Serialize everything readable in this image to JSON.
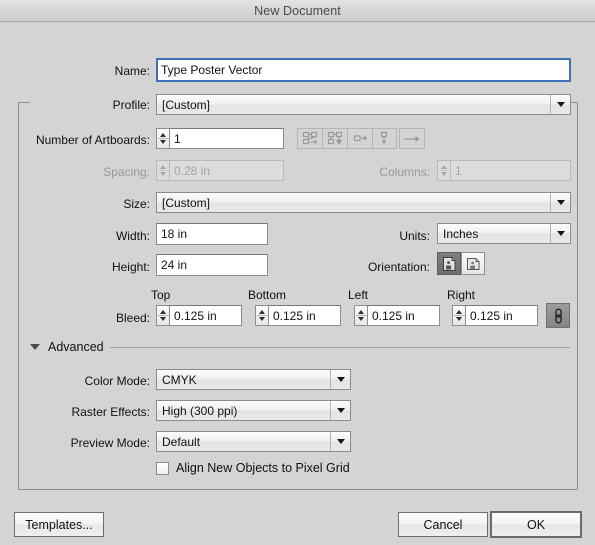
{
  "window": {
    "title": "New Document"
  },
  "fields": {
    "name_label": "Name:",
    "name_value": "Type Poster Vector",
    "profile_label": "Profile:",
    "profile_value": "[Custom]",
    "artboards_label": "Number of Artboards:",
    "artboards_value": "1",
    "spacing_label": "Spacing:",
    "spacing_value": "0.28 in",
    "columns_label": "Columns:",
    "columns_value": "1",
    "size_label": "Size:",
    "size_value": "[Custom]",
    "width_label": "Width:",
    "width_value": "18 in",
    "height_label": "Height:",
    "height_value": "24 in",
    "units_label": "Units:",
    "units_value": "Inches",
    "orientation_label": "Orientation:"
  },
  "bleed": {
    "label": "Bleed:",
    "top_label": "Top",
    "bottom_label": "Bottom",
    "left_label": "Left",
    "right_label": "Right",
    "top_value": "0.125 in",
    "bottom_value": "0.125 in",
    "left_value": "0.125 in",
    "right_value": "0.125 in"
  },
  "advanced": {
    "section_label": "Advanced",
    "color_mode_label": "Color Mode:",
    "color_mode_value": "CMYK",
    "raster_effects_label": "Raster Effects:",
    "raster_effects_value": "High (300 ppi)",
    "preview_mode_label": "Preview Mode:",
    "preview_mode_value": "Default",
    "align_pixel_grid_label": "Align New Objects to Pixel Grid"
  },
  "buttons": {
    "templates": "Templates...",
    "cancel": "Cancel",
    "ok": "OK"
  },
  "icons": {
    "artboard_grid_row": "grid-by-row-icon",
    "artboard_grid_column": "grid-by-column-icon",
    "artboard_row": "arrange-by-row-icon",
    "artboard_column": "arrange-by-column-icon",
    "artboard_direction": "right-to-left-arrow-icon",
    "orientation_portrait": "portrait-orientation-icon",
    "orientation_landscape": "landscape-orientation-icon",
    "bleed_link": "link-chain-icon",
    "disclosure": "disclosure-triangle-icon"
  },
  "colors": {
    "background": "#d4d4d4",
    "focus_border": "#3f6fb5",
    "text": "#111111",
    "disabled_text": "#a3a3a3",
    "title_text": "#4a4a4a"
  }
}
